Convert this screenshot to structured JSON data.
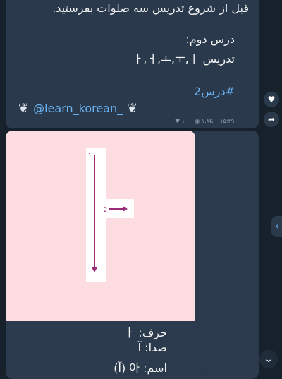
{
  "messages": [
    {
      "line1": "قبل از شروع تدریس سه صلوات بفرستید.",
      "line2": "درس دوم:",
      "line3": "تدریس ㅏ,ㅓ,ㅗ,ㅜ,ㅣ",
      "hashtag": "#درس2",
      "channel": "@learn_korean_",
      "meta": {
        "likes": "۱۰",
        "views": "۱.۸K",
        "time": "۱۵:۲۹"
      }
    },
    {
      "image": {
        "stroke1_label": "1",
        "stroke2_label": "2"
      },
      "caption": {
        "harf": "حرف: ㅏ",
        "seda": "صدا: آ",
        "esm": "اسم: 아 (آ)"
      }
    }
  ],
  "icons": {
    "heart": "heart-icon",
    "share": "share-icon",
    "views": "eye-icon",
    "scroll": "chevron-left-icon",
    "scroll_down": "chevron-down-icon"
  },
  "colors": {
    "link": "#6ab3f3",
    "arrow": "#9b2a78",
    "card": "#fddde2"
  }
}
